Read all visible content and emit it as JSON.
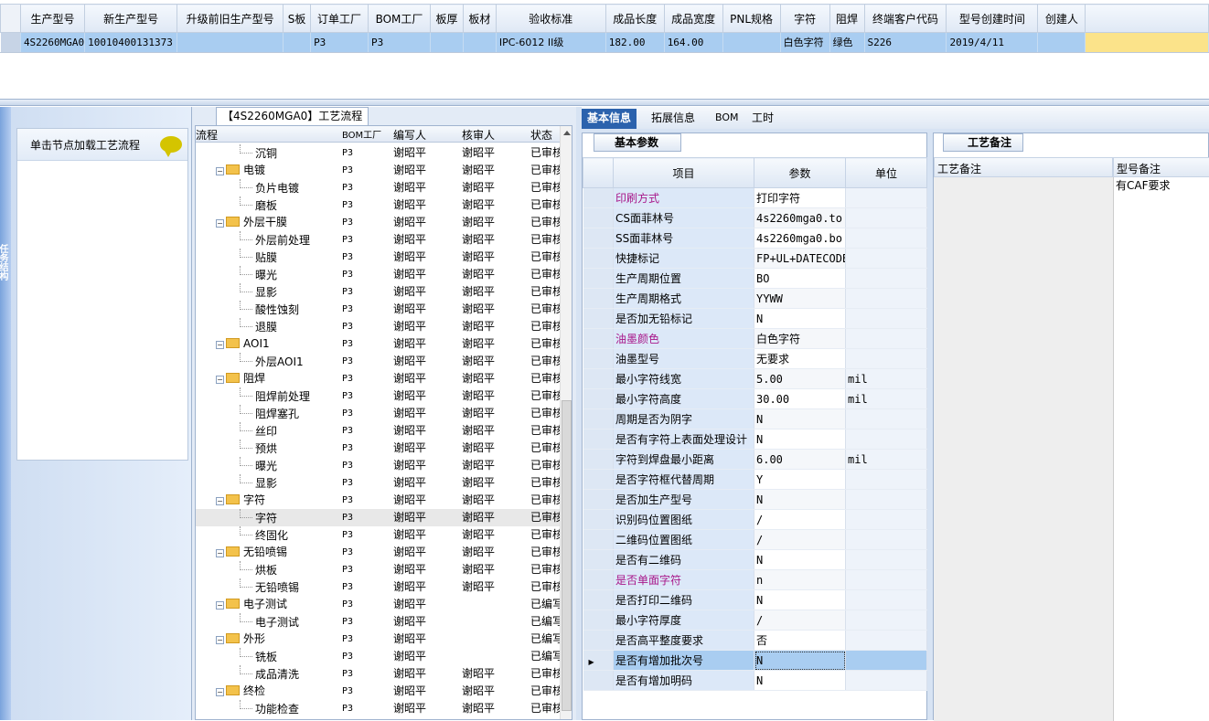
{
  "top_grid": {
    "columns": [
      "生产型号",
      "新生产型号",
      "升级前旧生产型号",
      "S板",
      "订单工厂",
      "BOM工厂",
      "板厚",
      "板材",
      "验收标准",
      "成品长度",
      "成品宽度",
      "PNL规格",
      "字符",
      "阻焊",
      "终端客户代码",
      "型号创建时间",
      "创建人"
    ],
    "row": [
      "4S2260MGA0",
      "10010400131373",
      "",
      "",
      "P3",
      "P3",
      "",
      "",
      "IPC-6012 II级",
      "182.00",
      "164.00",
      "",
      "白色字符",
      "绿色",
      "S226",
      "2019/4/11",
      ""
    ]
  },
  "left_panel": {
    "side_tab": "任务结构",
    "header": "单击节点加载工艺流程"
  },
  "tree": {
    "title": "【4S2260MGA0】工艺流程",
    "columns": [
      "流程",
      "BOM工厂",
      "编写人",
      "核审人",
      "状态"
    ],
    "rows": [
      {
        "level": 2,
        "name": "沉铜",
        "bom": "P3",
        "writer": "谢昭平",
        "reviewer": "谢昭平",
        "status": "已审核"
      },
      {
        "level": 1,
        "name": "电镀",
        "bom": "P3",
        "writer": "谢昭平",
        "reviewer": "谢昭平",
        "status": "已审核"
      },
      {
        "level": 2,
        "name": "负片电镀",
        "bom": "P3",
        "writer": "谢昭平",
        "reviewer": "谢昭平",
        "status": "已审核"
      },
      {
        "level": 2,
        "name": "磨板",
        "bom": "P3",
        "writer": "谢昭平",
        "reviewer": "谢昭平",
        "status": "已审核"
      },
      {
        "level": 1,
        "name": "外层干膜",
        "bom": "P3",
        "writer": "谢昭平",
        "reviewer": "谢昭平",
        "status": "已审核"
      },
      {
        "level": 2,
        "name": "外层前处理",
        "bom": "P3",
        "writer": "谢昭平",
        "reviewer": "谢昭平",
        "status": "已审核"
      },
      {
        "level": 2,
        "name": "贴膜",
        "bom": "P3",
        "writer": "谢昭平",
        "reviewer": "谢昭平",
        "status": "已审核"
      },
      {
        "level": 2,
        "name": "曝光",
        "bom": "P3",
        "writer": "谢昭平",
        "reviewer": "谢昭平",
        "status": "已审核"
      },
      {
        "level": 2,
        "name": "显影",
        "bom": "P3",
        "writer": "谢昭平",
        "reviewer": "谢昭平",
        "status": "已审核"
      },
      {
        "level": 2,
        "name": "酸性蚀刻",
        "bom": "P3",
        "writer": "谢昭平",
        "reviewer": "谢昭平",
        "status": "已审核"
      },
      {
        "level": 2,
        "name": "退膜",
        "bom": "P3",
        "writer": "谢昭平",
        "reviewer": "谢昭平",
        "status": "已审核"
      },
      {
        "level": 1,
        "name": "AOI1",
        "bom": "P3",
        "writer": "谢昭平",
        "reviewer": "谢昭平",
        "status": "已审核"
      },
      {
        "level": 2,
        "name": "外层AOI1",
        "bom": "P3",
        "writer": "谢昭平",
        "reviewer": "谢昭平",
        "status": "已审核"
      },
      {
        "level": 1,
        "name": "阻焊",
        "bom": "P3",
        "writer": "谢昭平",
        "reviewer": "谢昭平",
        "status": "已审核"
      },
      {
        "level": 2,
        "name": "阻焊前处理",
        "bom": "P3",
        "writer": "谢昭平",
        "reviewer": "谢昭平",
        "status": "已审核"
      },
      {
        "level": 2,
        "name": "阻焊塞孔",
        "bom": "P3",
        "writer": "谢昭平",
        "reviewer": "谢昭平",
        "status": "已审核"
      },
      {
        "level": 2,
        "name": "丝印",
        "bom": "P3",
        "writer": "谢昭平",
        "reviewer": "谢昭平",
        "status": "已审核"
      },
      {
        "level": 2,
        "name": "预烘",
        "bom": "P3",
        "writer": "谢昭平",
        "reviewer": "谢昭平",
        "status": "已审核"
      },
      {
        "level": 2,
        "name": "曝光",
        "bom": "P3",
        "writer": "谢昭平",
        "reviewer": "谢昭平",
        "status": "已审核"
      },
      {
        "level": 2,
        "name": "显影",
        "bom": "P3",
        "writer": "谢昭平",
        "reviewer": "谢昭平",
        "status": "已审核"
      },
      {
        "level": 1,
        "name": "字符",
        "bom": "P3",
        "writer": "谢昭平",
        "reviewer": "谢昭平",
        "status": "已审核"
      },
      {
        "level": 2,
        "name": "字符",
        "bom": "P3",
        "writer": "谢昭平",
        "reviewer": "谢昭平",
        "status": "已审核",
        "selected": true
      },
      {
        "level": 2,
        "name": "终固化",
        "bom": "P3",
        "writer": "谢昭平",
        "reviewer": "谢昭平",
        "status": "已审核"
      },
      {
        "level": 1,
        "name": "无铅喷锡",
        "bom": "P3",
        "writer": "谢昭平",
        "reviewer": "谢昭平",
        "status": "已审核"
      },
      {
        "level": 2,
        "name": "烘板",
        "bom": "P3",
        "writer": "谢昭平",
        "reviewer": "谢昭平",
        "status": "已审核"
      },
      {
        "level": 2,
        "name": "无铅喷锡",
        "bom": "P3",
        "writer": "谢昭平",
        "reviewer": "谢昭平",
        "status": "已审核"
      },
      {
        "level": 1,
        "name": "电子测试",
        "bom": "P3",
        "writer": "谢昭平",
        "reviewer": "",
        "status": "已编写"
      },
      {
        "level": 2,
        "name": "电子测试",
        "bom": "P3",
        "writer": "谢昭平",
        "reviewer": "",
        "status": "已编写"
      },
      {
        "level": 1,
        "name": "外形",
        "bom": "P3",
        "writer": "谢昭平",
        "reviewer": "",
        "status": "已编写"
      },
      {
        "level": 2,
        "name": "铣板",
        "bom": "P3",
        "writer": "谢昭平",
        "reviewer": "",
        "status": "已编写"
      },
      {
        "level": 2,
        "name": "成品清洗",
        "bom": "P3",
        "writer": "谢昭平",
        "reviewer": "谢昭平",
        "status": "已审核"
      },
      {
        "level": 1,
        "name": "终检",
        "bom": "P3",
        "writer": "谢昭平",
        "reviewer": "谢昭平",
        "status": "已审核"
      },
      {
        "level": 2,
        "name": "功能检查",
        "bom": "P3",
        "writer": "谢昭平",
        "reviewer": "谢昭平",
        "status": "已审核"
      }
    ]
  },
  "tabs": [
    "基本信息",
    "拓展信息",
    "BOM",
    "工时"
  ],
  "params": {
    "tab": "基本参数",
    "columns": [
      "项目",
      "参数",
      "单位"
    ],
    "rows": [
      {
        "item": "印刷方式",
        "value": "打印字符",
        "unit": "",
        "pink": true
      },
      {
        "item": "CS面菲林号",
        "value": "4s2260mga0.to",
        "unit": ""
      },
      {
        "item": "SS面菲林号",
        "value": "4s2260mga0.bo",
        "unit": ""
      },
      {
        "item": "快捷标记",
        "value": "FP+UL+DATECODE",
        "unit": ""
      },
      {
        "item": "生产周期位置",
        "value": "BO",
        "unit": ""
      },
      {
        "item": "生产周期格式",
        "value": "YYWW",
        "unit": ""
      },
      {
        "item": "是否加无铅标记",
        "value": "N",
        "unit": ""
      },
      {
        "item": "油墨颜色",
        "value": "白色字符",
        "unit": "",
        "pink": true
      },
      {
        "item": "油墨型号",
        "value": "无要求",
        "unit": ""
      },
      {
        "item": "最小字符线宽",
        "value": "5.00",
        "unit": "mil"
      },
      {
        "item": "最小字符高度",
        "value": "30.00",
        "unit": "mil"
      },
      {
        "item": "周期是否为阴字",
        "value": "N",
        "unit": ""
      },
      {
        "item": "是否有字符上表面处理设计",
        "value": "N",
        "unit": ""
      },
      {
        "item": "字符到焊盘最小距离",
        "value": "6.00",
        "unit": "mil"
      },
      {
        "item": "是否字符框代替周期",
        "value": "Y",
        "unit": ""
      },
      {
        "item": "是否加生产型号",
        "value": "N",
        "unit": ""
      },
      {
        "item": "识别码位置图纸",
        "value": "/",
        "unit": ""
      },
      {
        "item": "二维码位置图纸",
        "value": "/",
        "unit": ""
      },
      {
        "item": "是否有二维码",
        "value": "N",
        "unit": ""
      },
      {
        "item": "是否单面字符",
        "value": "n",
        "unit": "",
        "pink": true
      },
      {
        "item": "是否打印二维码",
        "value": "N",
        "unit": ""
      },
      {
        "item": "最小字符厚度",
        "value": "/",
        "unit": ""
      },
      {
        "item": "是否高平整度要求",
        "value": "否",
        "unit": ""
      },
      {
        "item": "是否有增加批次号",
        "value": "N",
        "unit": "",
        "current": true
      },
      {
        "item": "是否有增加明码",
        "value": "N",
        "unit": ""
      }
    ]
  },
  "notes": {
    "tab": "工艺备注",
    "col1": "工艺备注",
    "col2": "型号备注",
    "model_note": "有CAF要求"
  }
}
